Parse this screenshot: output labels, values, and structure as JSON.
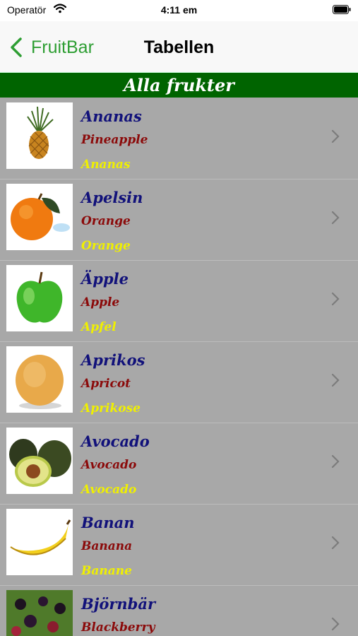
{
  "status_bar": {
    "carrier": "Operatör",
    "time": "4:11 em"
  },
  "nav": {
    "back_label": "FruitBar",
    "title": "Tabellen"
  },
  "section": {
    "title": "Alla frukter"
  },
  "fruits": [
    {
      "sv": "Ananas",
      "en": "Pineapple",
      "de": "Ananas",
      "icon": "pineapple-icon"
    },
    {
      "sv": "Apelsin",
      "en": "Orange",
      "de": "Orange",
      "icon": "orange-icon"
    },
    {
      "sv": "Äpple",
      "en": "Apple",
      "de": "Apfel",
      "icon": "apple-icon"
    },
    {
      "sv": "Aprikos",
      "en": "Apricot",
      "de": "Aprikose",
      "icon": "apricot-icon"
    },
    {
      "sv": "Avocado",
      "en": "Avocado",
      "de": "Avocado",
      "icon": "avocado-icon"
    },
    {
      "sv": "Banan",
      "en": "Banana",
      "de": "Banane",
      "icon": "banana-icon"
    },
    {
      "sv": "Björnbär",
      "en": "Blackberry",
      "de": "",
      "icon": "blackberry-icon"
    }
  ],
  "colors": {
    "nav_accent": "#2e9e33",
    "section_bg": "#006400",
    "list_bg": "#a8a8a8",
    "name_sv": "#11117a",
    "name_en": "#8b0a0a",
    "name_de": "#f0f000"
  }
}
